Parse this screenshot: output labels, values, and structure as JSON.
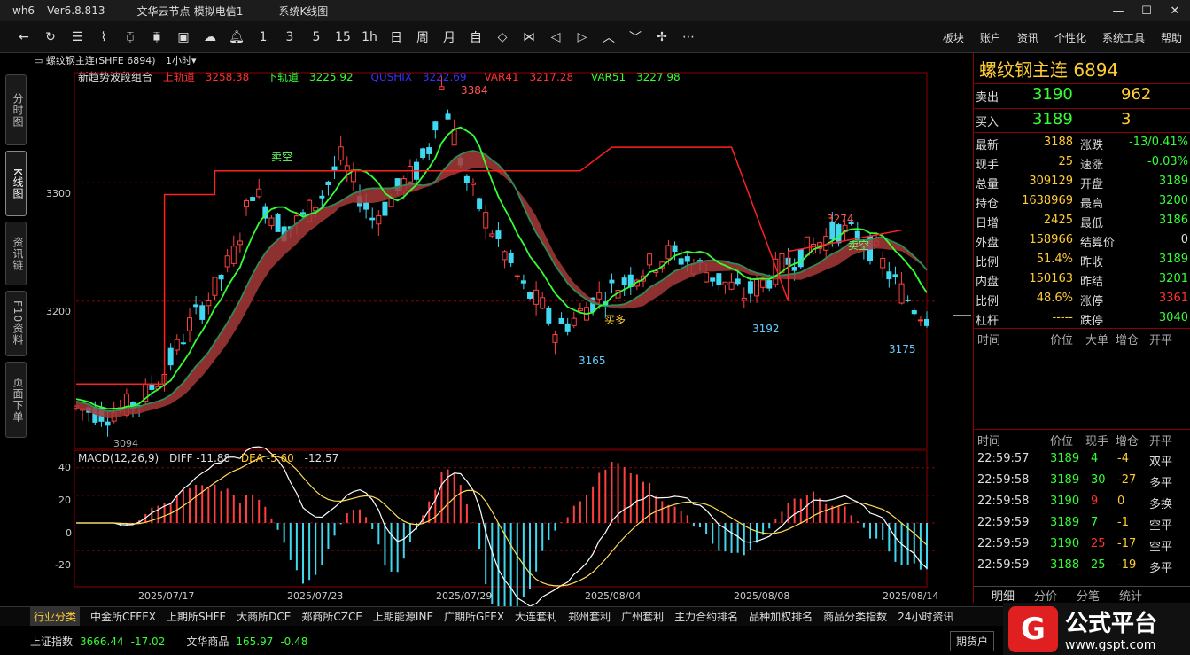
{
  "window": {
    "app": "wh6",
    "version": "Ver6.8.813",
    "node": "文华云节点-模拟电信1",
    "page": "系统K线图"
  },
  "toolbar_icons": [
    "back-icon",
    "refresh-icon",
    "list-icon",
    "line-chart-icon",
    "candle-icon",
    "candle-alt-icon",
    "screen-icon",
    "cloud-icon",
    "bell-icon"
  ],
  "toolbar_labels": [
    "1",
    "3",
    "5",
    "15",
    "1h",
    "日",
    "周",
    "月",
    "自"
  ],
  "menu": [
    "板块",
    "账户",
    "资讯",
    "个性化",
    "系统工具",
    "帮助"
  ],
  "left_tabs": [
    "分时图",
    "K线图",
    "资讯链",
    "F10资料",
    "页面下单"
  ],
  "chart_header": {
    "symbol": "螺纹钢主连(SHFE 6894)",
    "period": "1小时"
  },
  "legend": {
    "name": "新趋势波段组合",
    "upper": "上轨道",
    "upper_val": "3258.38",
    "lower": "下轨道",
    "lower_val": "3225.92",
    "qu": "QUSHIX",
    "qu_val": "3222.69",
    "var41": "VAR41",
    "var41_val": "3217.28",
    "var51": "VAR51",
    "var51_val": "3227.98"
  },
  "macd": {
    "label": "MACD(12,26,9)",
    "diff": "DIFF -11.88",
    "dea": "DEA -5.60",
    "macd": "-12.57"
  },
  "chart_data": {
    "type": "candlestick",
    "y_ticks": [
      "3300",
      "3200"
    ],
    "macd_ticks": [
      "40",
      "20",
      "0",
      "-20"
    ],
    "x_ticks": [
      "2025/07/17",
      "2025/07/23",
      "2025/07/29",
      "2025/08/04",
      "2025/08/08",
      "2025/08/14"
    ],
    "annotations": [
      "3384",
      "3165",
      "3192",
      "3274",
      "3175",
      "卖空",
      "卖空",
      "买多",
      "3094"
    ],
    "ylim": [
      3080,
      3390
    ]
  },
  "right": {
    "title": "螺纹钢主连",
    "code": "6894",
    "sell": {
      "label": "卖出",
      "price": "3190",
      "vol": "962"
    },
    "buy": {
      "label": "买入",
      "price": "3189",
      "vol": "3"
    },
    "left": [
      [
        "最新",
        "3188"
      ],
      [
        "现手",
        "25"
      ],
      [
        "总量",
        "309129"
      ],
      [
        "持仓",
        "1638969"
      ],
      [
        "日增",
        "2425"
      ],
      [
        "外盘",
        "158966"
      ],
      [
        "比例",
        "51.4%"
      ],
      [
        "内盘",
        "150163"
      ],
      [
        "比例",
        "48.6%"
      ],
      [
        "杠杆",
        "-----"
      ]
    ],
    "right": [
      [
        "涨跌",
        "-13/0.41%"
      ],
      [
        "速涨",
        "-0.03%"
      ],
      [
        "开盘",
        "3189"
      ],
      [
        "最高",
        "3200"
      ],
      [
        "最低",
        "3186"
      ],
      [
        "结算价",
        "0"
      ],
      [
        "昨收",
        "3189"
      ],
      [
        "昨结",
        "3201"
      ],
      [
        "涨停",
        "3361"
      ],
      [
        "跌停",
        "3040"
      ]
    ],
    "th": [
      "时间",
      "价位",
      "大单",
      "增仓",
      "开平"
    ],
    "th2": [
      "时间",
      "价位",
      "现手",
      "增仓",
      "开平"
    ],
    "ticks": [
      [
        "22:59:57",
        "3189",
        "4",
        "-4",
        "双平"
      ],
      [
        "22:59:58",
        "3189",
        "30",
        "-27",
        "多平"
      ],
      [
        "22:59:58",
        "3190",
        "9",
        "0",
        "多换"
      ],
      [
        "22:59:59",
        "3189",
        "7",
        "-1",
        "空平"
      ],
      [
        "22:59:59",
        "3190",
        "25",
        "-17",
        "空平"
      ],
      [
        "22:59:59",
        "3188",
        "25",
        "-19",
        "多平"
      ]
    ],
    "tabs": [
      "明细",
      "分价",
      "分笔",
      "统计"
    ]
  },
  "exchange_tabs": [
    "行业分类",
    "中金所CFFEX",
    "上期所SHFE",
    "大商所DCE",
    "郑商所CZCE",
    "上期能源INE",
    "广期所GFEX",
    "大连套利",
    "郑州套利",
    "广州套利",
    "主力合约排名",
    "品种加权排名",
    "商品分类指数",
    "24小时资讯"
  ],
  "status": {
    "idx1": "上证指数",
    "idx1_val": "3666.44",
    "idx1_chg": "-17.02",
    "idx2": "文华商品",
    "idx2_val": "165.97",
    "idx2_chg": "-0.48",
    "btn": "期货户"
  },
  "brand": {
    "name": "公式平台",
    "url": "www.gspt.com"
  }
}
